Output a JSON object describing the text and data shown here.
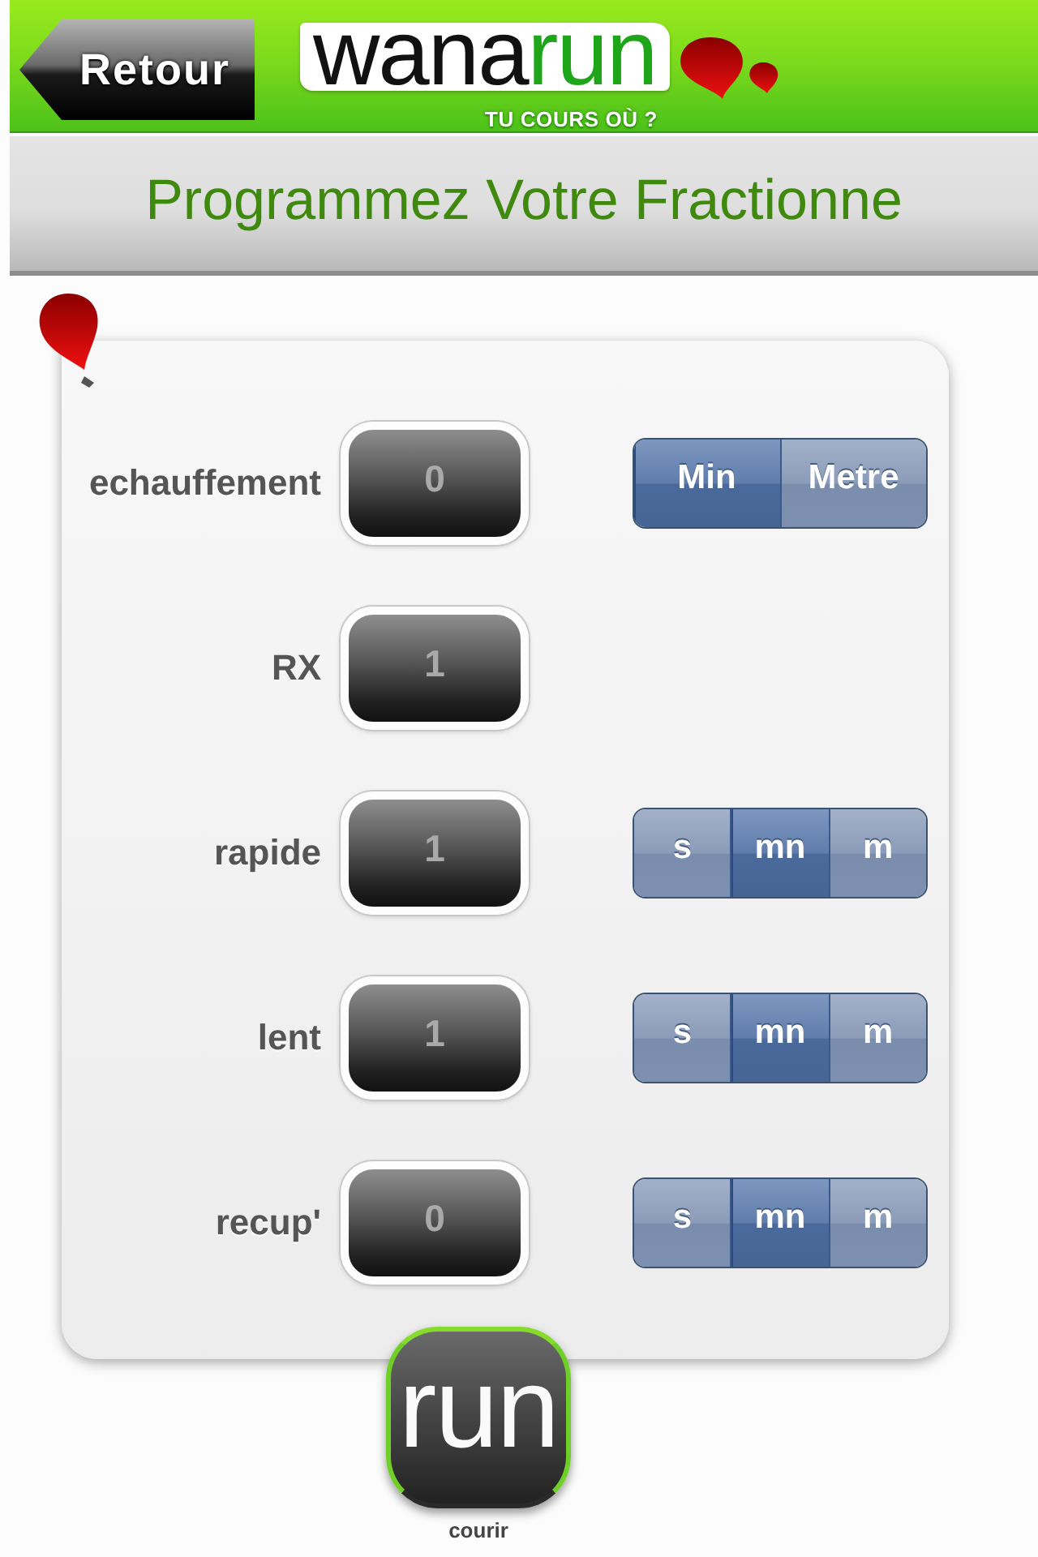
{
  "header": {
    "back_button": "Retour",
    "logo": {
      "parts": [
        {
          "text": "wana",
          "kind": "plain"
        },
        {
          "text": "run",
          "kind": "accent"
        }
      ],
      "tagline": "TU COURS OÙ ?"
    }
  },
  "title": "Programmez Votre Fractionne",
  "rows": [
    {
      "label": "echauffement",
      "value": "0",
      "units": [
        {
          "label": "Min",
          "selected": true
        },
        {
          "label": "Metre",
          "selected": false
        }
      ]
    },
    {
      "label": "RX",
      "value": "1"
    },
    {
      "label": "rapide",
      "value": "1",
      "units": [
        {
          "label": "s",
          "selected": false
        },
        {
          "label": "mn",
          "selected": true
        },
        {
          "label": "m",
          "selected": false
        }
      ]
    },
    {
      "label": "lent",
      "value": "1",
      "units": [
        {
          "label": "s",
          "selected": false
        },
        {
          "label": "mn",
          "selected": true
        },
        {
          "label": "m",
          "selected": false
        }
      ]
    },
    {
      "label": "recup'",
      "value": "0",
      "units": [
        {
          "label": "s",
          "selected": false
        },
        {
          "label": "mn",
          "selected": true
        },
        {
          "label": "m",
          "selected": false
        }
      ]
    }
  ],
  "run_button": {
    "label": "run",
    "caption": "courir"
  }
}
